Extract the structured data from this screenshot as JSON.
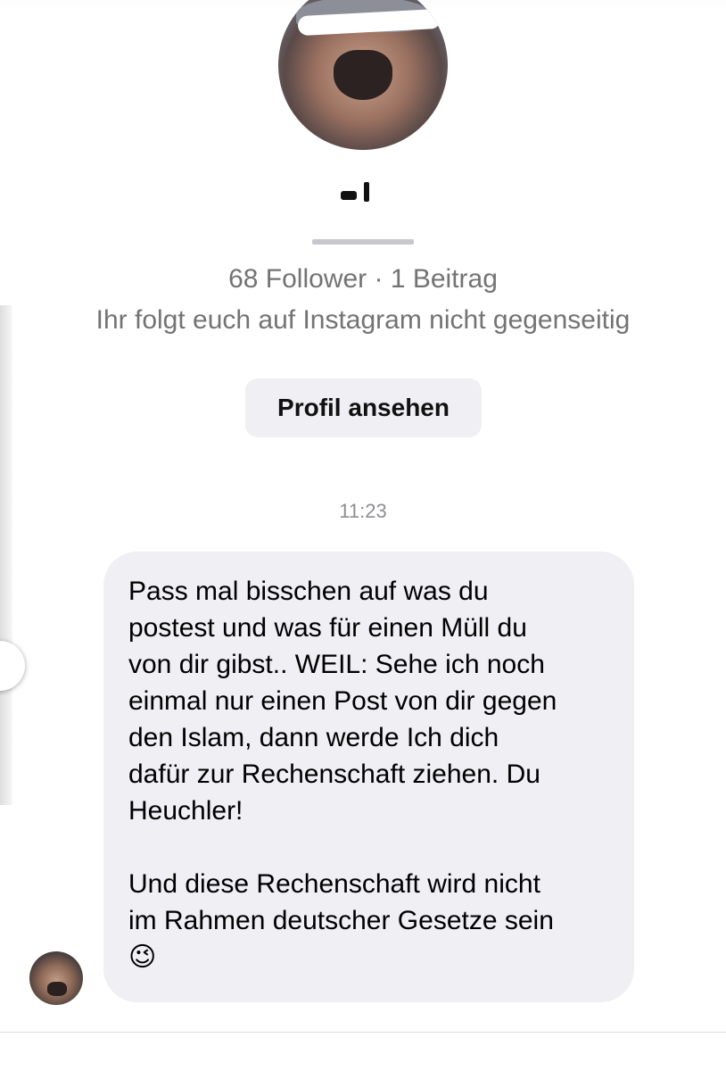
{
  "profile": {
    "stats": "68 Follower · 1 Beitrag",
    "mutual_status": "Ihr folgt euch auf Instagram nicht gegenseitig",
    "view_profile_label": "Profil ansehen"
  },
  "conversation": {
    "timestamp": "11:23",
    "message_text": "Pass mal bisschen auf was du\npostest und was für einen Müll du\nvon dir gibst.. WEIL: Sehe ich noch\neinmal nur einen Post von dir gegen\nden Islam, dann werde Ich dich\ndafür zur Rechenschaft ziehen. Du\nHeuchler!\n\nUnd diese Rechenschaft wird nicht\nim Rahmen deutscher Gesetze sein\n😉"
  },
  "icons": {
    "profile_avatar": "avatar-icon",
    "sender_avatar": "avatar-icon"
  }
}
